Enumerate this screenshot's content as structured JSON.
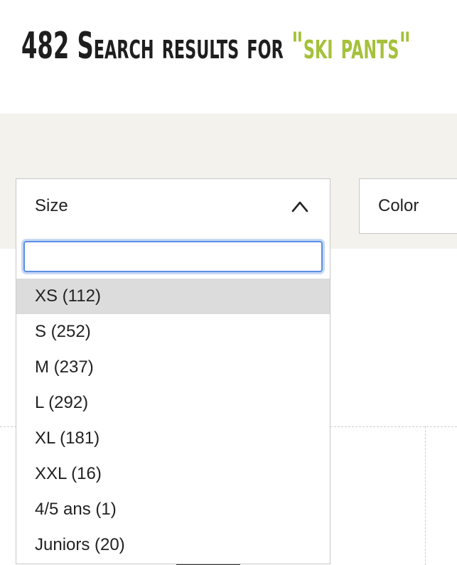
{
  "heading": {
    "prefix": "482 Search results for ",
    "query": "\"ski pants\""
  },
  "filters": {
    "size": {
      "label": "Size",
      "expanded": true,
      "search_value": "",
      "options": [
        {
          "label": "XS (112)",
          "highlighted": true
        },
        {
          "label": "S (252)",
          "highlighted": false
        },
        {
          "label": "M (237)",
          "highlighted": false
        },
        {
          "label": "L (292)",
          "highlighted": false
        },
        {
          "label": "XL (181)",
          "highlighted": false
        },
        {
          "label": "XXL (16)",
          "highlighted": false
        },
        {
          "label": "4/5 ans (1)",
          "highlighted": false
        },
        {
          "label": "Juniors (20)",
          "highlighted": false
        }
      ]
    },
    "color": {
      "label": "Color"
    }
  },
  "icons": {
    "size_chevron": "chevron-up-icon"
  },
  "colors": {
    "heading": "#1e1e1e",
    "query_accent": "#a5c13a",
    "filter_band": "#f4f2ed",
    "focus_ring": "#5b8fe6",
    "highlight": "#dcdcdc"
  }
}
